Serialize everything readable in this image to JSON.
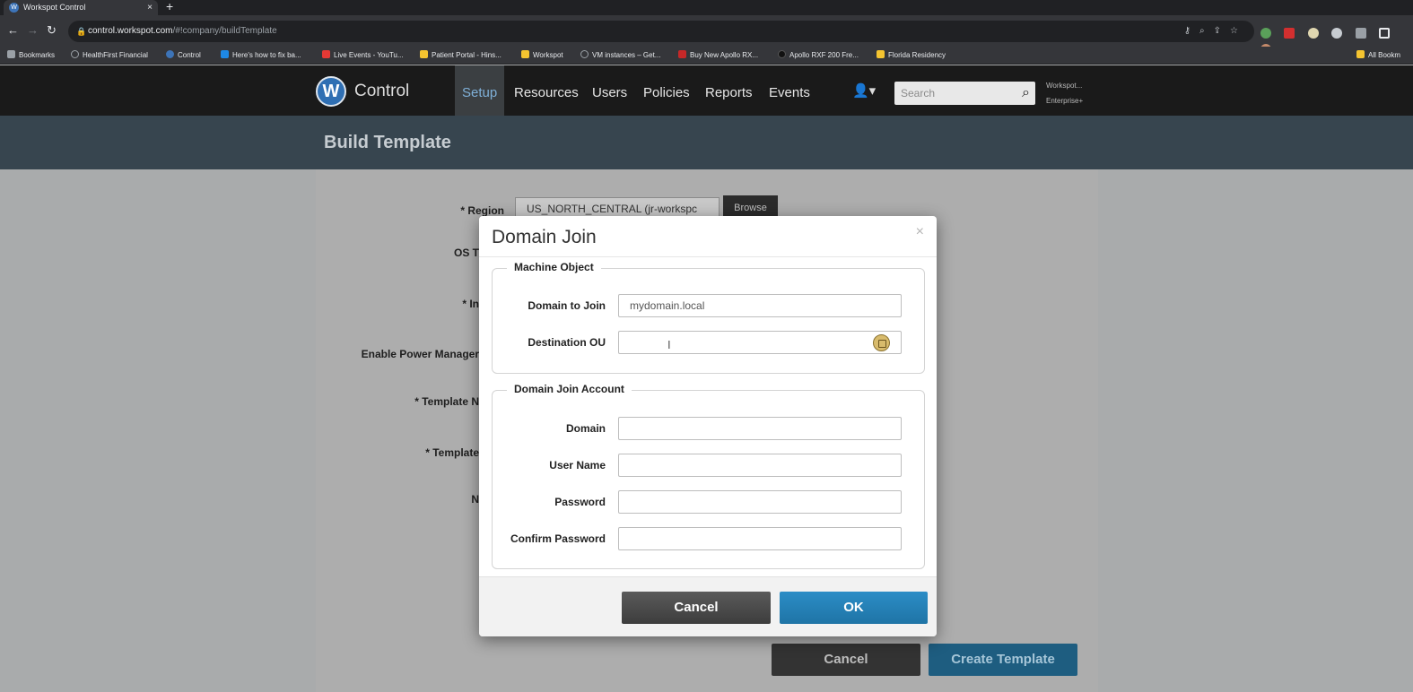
{
  "browser": {
    "tab_title": "Workspot Control",
    "tab_close": "×",
    "new_tab": "+",
    "url_host": "control.workspot.com",
    "url_path": "/#!company/buildTemplate",
    "bookmarks": [
      {
        "label": "Bookmarks",
        "color": "#9aa0a6"
      },
      {
        "label": "HealthFirst Financial",
        "color": "#9aa0a6"
      },
      {
        "label": "Control",
        "color": "#3d74b8"
      },
      {
        "label": "Here's how to fix ba...",
        "color": "#1e88e5"
      },
      {
        "label": "Live Events - YouTu...",
        "color": "#e53935"
      },
      {
        "label": "Patient Portal - Hins...",
        "color": "#f4c430"
      },
      {
        "label": "Workspot",
        "color": "#f4c430"
      },
      {
        "label": "VM instances – Get...",
        "color": "#9aa0a6"
      },
      {
        "label": "Buy New Apollo RX...",
        "color": "#c62828"
      },
      {
        "label": "Apollo RXF 200 Fre...",
        "color": "#111111"
      },
      {
        "label": "Florida Residency",
        "color": "#f4c430"
      }
    ],
    "all_bookmarks": "All Bookm"
  },
  "app": {
    "logo_letter": "W",
    "brand": "Control",
    "nav": [
      "Setup",
      "Resources",
      "Users",
      "Policies",
      "Reports",
      "Events"
    ],
    "active_nav": "Setup",
    "search_placeholder": "Search",
    "account_line1": "Workspot...",
    "account_line2": "Enterprise+"
  },
  "page": {
    "title": "Build Template",
    "labels": {
      "region": "* Region",
      "os": "OS T",
      "image": "* In",
      "power": "Enable Power Manager",
      "template_name": "* Template N",
      "template": "* Template",
      "notes": "N"
    },
    "region_value": "US_NORTH_CENTRAL (jr-workspc",
    "browse_label": "Browse",
    "cancel_label": "Cancel",
    "create_label": "Create Template"
  },
  "modal": {
    "title": "Domain Join",
    "close": "×",
    "machine_object": {
      "legend": "Machine Object",
      "domain_label": "Domain to Join",
      "domain_value": "mydomain.local",
      "ou_label": "Destination OU",
      "ou_value": "",
      "cursor": "I"
    },
    "join_account": {
      "legend": "Domain Join Account",
      "domain_label": "Domain",
      "username_label": "User Name",
      "password_label": "Password",
      "confirm_label": "Confirm Password"
    },
    "cancel_label": "Cancel",
    "ok_label": "OK"
  }
}
